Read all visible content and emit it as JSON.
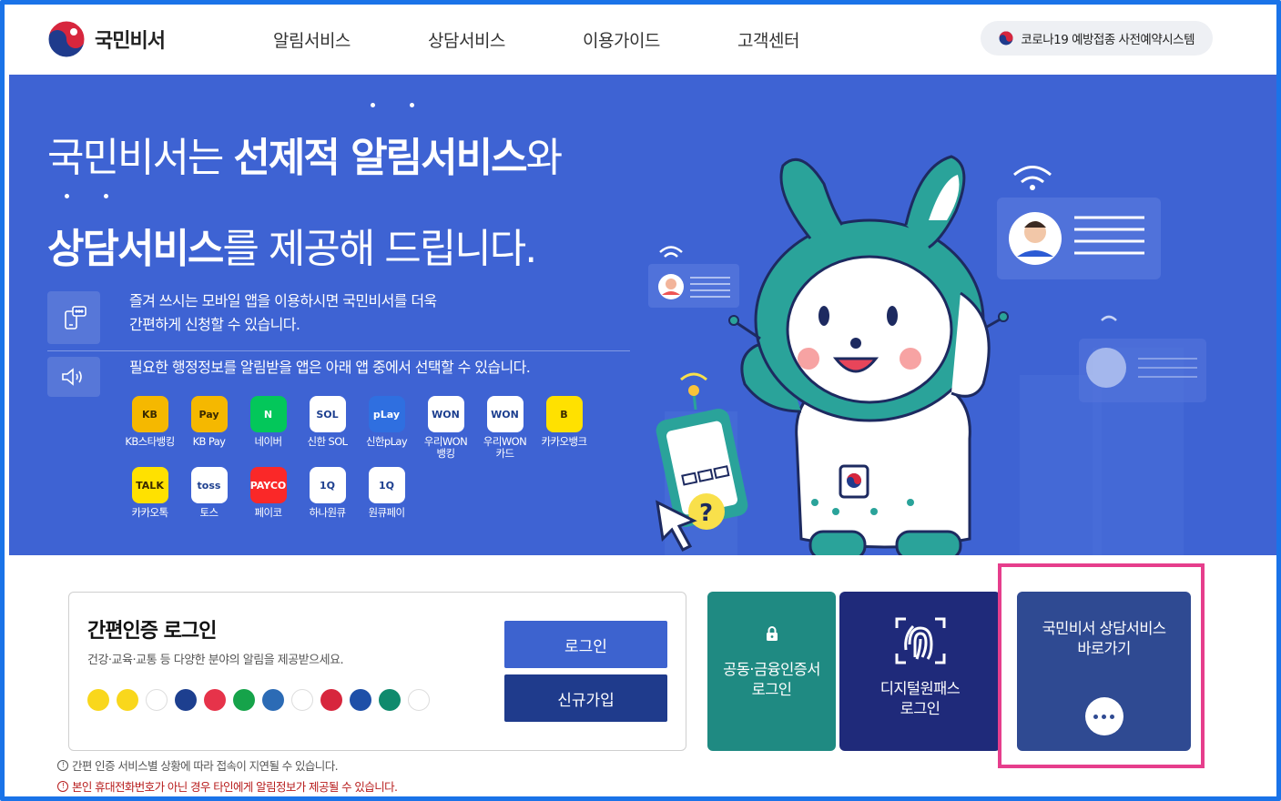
{
  "header": {
    "logo_text": "국민비서",
    "nav": [
      "알림서비스",
      "상담서비스",
      "이용가이드",
      "고객센터"
    ],
    "covid_button": "코로나19 예방접종 사전예약시스템"
  },
  "hero": {
    "line1_normal": "국민비서는 ",
    "line1_bold": "선제적 알림서비스",
    "line1_tail": "와",
    "line2_bold": "상담서비스",
    "line2_tail": "를 제공해 드립니다.",
    "info1_line1": "즐겨 쓰시는 모바일 앱을 이용하시면 국민비서를 더욱",
    "info1_line2": "간편하게 신청할 수 있습니다.",
    "info2": "필요한 행정정보를 알림받을 앱은 아래 앱 중에서 선택할 수 있습니다.",
    "apps": [
      {
        "label": "KB스타뱅킹",
        "icon_text": "KB",
        "color": "#f5b800"
      },
      {
        "label": "KB Pay",
        "icon_text": "Pay",
        "color": "#f5b800"
      },
      {
        "label": "네이버",
        "icon_text": "N",
        "color": "#03c75a"
      },
      {
        "label": "신한 SOL",
        "icon_text": "SOL",
        "color": "#ffffff"
      },
      {
        "label": "신한pLay",
        "icon_text": "pLay",
        "color": "#2f6fe0"
      },
      {
        "label": "우리WON\n뱅킹",
        "icon_text": "WON",
        "color": "#ffffff"
      },
      {
        "label": "우리WON\n카드",
        "icon_text": "WON",
        "color": "#ffffff"
      },
      {
        "label": "카카오뱅크",
        "icon_text": "B",
        "color": "#ffe100"
      },
      {
        "label": "카카오톡",
        "icon_text": "TALK",
        "color": "#ffe100"
      },
      {
        "label": "토스",
        "icon_text": "toss",
        "color": "#ffffff"
      },
      {
        "label": "페이코",
        "icon_text": "PAYCO",
        "color": "#fa2828"
      },
      {
        "label": "하나원큐",
        "icon_text": "1Q",
        "color": "#ffffff"
      },
      {
        "label": "원큐페이",
        "icon_text": "1Q",
        "color": "#ffffff"
      }
    ]
  },
  "login": {
    "title": "간편인증 로그인",
    "desc": "건강·교육·교통 등 다양한 분야의 알림을 제공받으세요.",
    "login_button": "로그인",
    "signup_button": "신규가입",
    "cert_colors": [
      "#f9d71c",
      "#f9d71c",
      "#ffffff",
      "#1d3f8f",
      "#e6334a",
      "#16a34a",
      "#2c6bb5",
      "#ffffff",
      "#d7263d",
      "#1e4fa8",
      "#0f8a6d",
      "#ffffff"
    ],
    "notice1": "간편 인증 서비스별 상황에 따라 접속이 지연될 수 있습니다.",
    "notice2": "본인 휴대전화번호가 아닌 경우 타인에게 알림정보가 제공될 수 있습니다."
  },
  "tiles": {
    "cert_line1": "공동·금융인증서",
    "cert_line2": "로그인",
    "digital_line1": "디지털원패스",
    "digital_line2": "로그인",
    "consult_line1": "국민비서 상담서비스",
    "consult_line2": "바로가기"
  }
}
